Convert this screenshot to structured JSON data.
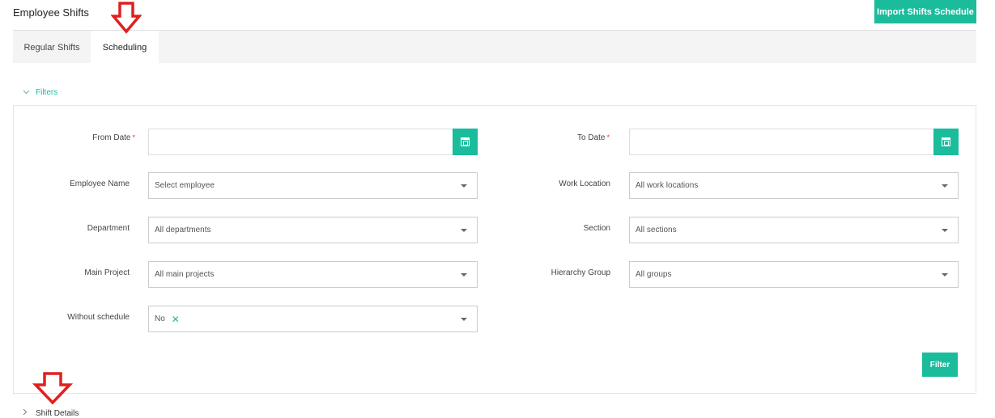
{
  "page": {
    "title": "Employee Shifts"
  },
  "header": {
    "import_label": "Import Shifts Schedule"
  },
  "tabs": [
    {
      "label": "Regular Shifts",
      "active": false
    },
    {
      "label": "Scheduling",
      "active": true
    }
  ],
  "filters": {
    "toggle_label": "Filters",
    "from_date": {
      "label": "From Date",
      "required": "*",
      "value": ""
    },
    "to_date": {
      "label": "To Date",
      "required": "*",
      "value": ""
    },
    "employee_name": {
      "label": "Employee Name",
      "value": "Select employee"
    },
    "work_location": {
      "label": "Work Location",
      "value": "All work locations"
    },
    "department": {
      "label": "Department",
      "value": "All departments"
    },
    "section": {
      "label": "Section",
      "value": "All sections"
    },
    "main_project": {
      "label": "Main Project",
      "value": "All main projects"
    },
    "hierarchy_group": {
      "label": "Hierarchy Group",
      "value": "All groups"
    },
    "without_schedule": {
      "label": "Without schedule",
      "value": "No",
      "remove_glyph": "✕"
    },
    "filter_label": "Filter"
  },
  "shift_details": {
    "toggle_label": "Shift Details"
  },
  "colors": {
    "accent": "#1abc9c",
    "annotation": "#e02020"
  }
}
